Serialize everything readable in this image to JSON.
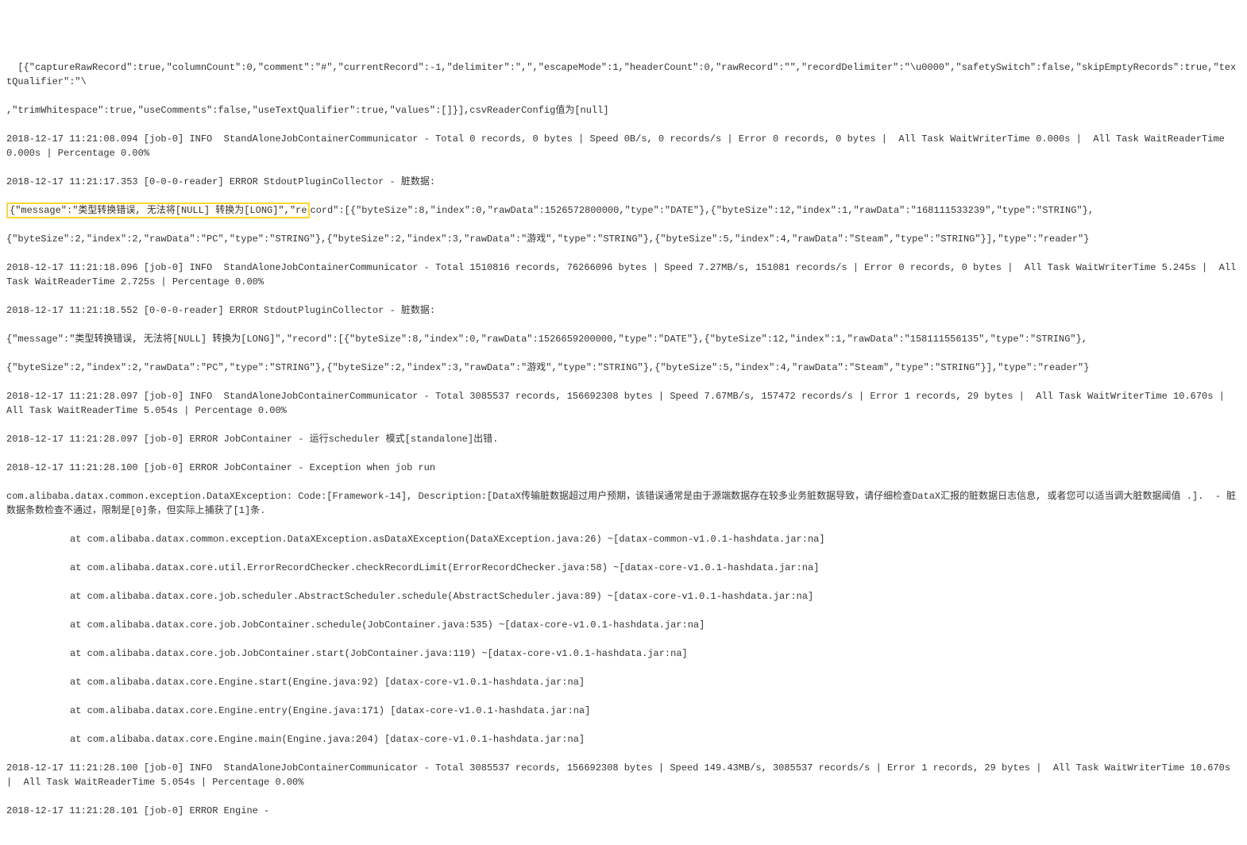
{
  "lines": {
    "l0": "  [{\"captureRawRecord\":true,\"columnCount\":0,\"comment\":\"#\",\"currentRecord\":-1,\"delimiter\":\",\",\"escapeMode\":1,\"headerCount\":0,\"rawRecord\":\"\",\"recordDelimiter\":\"\\u0000\",\"safetySwitch\":false,\"skipEmptyRecords\":true,\"textQualifier\":\"\\",
    "l1": ",\"trimWhitespace\":true,\"useComments\":false,\"useTextQualifier\":true,\"values\":[]}],csvReaderConfig值为[null]",
    "l2": "2018-12-17 11:21:08.094 [job-0] INFO  StandAloneJobContainerCommunicator - Total 0 records, 0 bytes | Speed 0B/s, 0 records/s | Error 0 records, 0 bytes |  All Task WaitWriterTime 0.000s |  All Task WaitReaderTime 0.000s | Percentage 0.00%",
    "l3_a": "2018-12-17 11:21:17.353 [0-0-0-reader] ERROR StdoutPluginCollector - 脏数据:",
    "l4_hl": "{\"message\":\"类型转换错误, 无法将[NULL] 转换为[LONG]\",\"re",
    "l4_rest": "cord\":[{\"byteSize\":8,\"index\":0,\"rawData\":1526572800000,\"type\":\"DATE\"},{\"byteSize\":12,\"index\":1,\"rawData\":\"168111533239\",\"type\":\"STRING\"},",
    "l5": "{\"byteSize\":2,\"index\":2,\"rawData\":\"PC\",\"type\":\"STRING\"},{\"byteSize\":2,\"index\":3,\"rawData\":\"游戏\",\"type\":\"STRING\"},{\"byteSize\":5,\"index\":4,\"rawData\":\"Steam\",\"type\":\"STRING\"}],\"type\":\"reader\"}",
    "l6": "2018-12-17 11:21:18.096 [job-0] INFO  StandAloneJobContainerCommunicator - Total 1510816 records, 76266096 bytes | Speed 7.27MB/s, 151081 records/s | Error 0 records, 0 bytes |  All Task WaitWriterTime 5.245s |  All Task WaitReaderTime 2.725s | Percentage 0.00%",
    "l7": "2018-12-17 11:21:18.552 [0-0-0-reader] ERROR StdoutPluginCollector - 脏数据:",
    "l8": "{\"message\":\"类型转换错误, 无法将[NULL] 转换为[LONG]\",\"record\":[{\"byteSize\":8,\"index\":0,\"rawData\":1526659200000,\"type\":\"DATE\"},{\"byteSize\":12,\"index\":1,\"rawData\":\"158111556135\",\"type\":\"STRING\"},",
    "l9": "{\"byteSize\":2,\"index\":2,\"rawData\":\"PC\",\"type\":\"STRING\"},{\"byteSize\":2,\"index\":3,\"rawData\":\"游戏\",\"type\":\"STRING\"},{\"byteSize\":5,\"index\":4,\"rawData\":\"Steam\",\"type\":\"STRING\"}],\"type\":\"reader\"}",
    "l10": "2018-12-17 11:21:28.097 [job-0] INFO  StandAloneJobContainerCommunicator - Total 3085537 records, 156692308 bytes | Speed 7.67MB/s, 157472 records/s | Error 1 records, 29 bytes |  All Task WaitWriterTime 10.670s |  All Task WaitReaderTime 5.054s | Percentage 0.00%",
    "l11": "2018-12-17 11:21:28.097 [job-0] ERROR JobContainer - 运行scheduler 模式[standalone]出错.",
    "l12": "2018-12-17 11:21:28.100 [job-0] ERROR JobContainer - Exception when job run",
    "l13": "com.alibaba.datax.common.exception.DataXException: Code:[Framework-14], Description:[DataX传输脏数据超过用户预期，该错误通常是由于源端数据存在较多业务脏数据导致，请仔细检查DataX汇报的脏数据日志信息, 或者您可以适当调大脏数据阈值 .].  - 脏数据条数检查不通过，限制是[0]条，但实际上捕获了[1]条.",
    "st0": "at com.alibaba.datax.common.exception.DataXException.asDataXException(DataXException.java:26) ~[datax-common-v1.0.1-hashdata.jar:na]",
    "st1": "at com.alibaba.datax.core.util.ErrorRecordChecker.checkRecordLimit(ErrorRecordChecker.java:58) ~[datax-core-v1.0.1-hashdata.jar:na]",
    "st2": "at com.alibaba.datax.core.job.scheduler.AbstractScheduler.schedule(AbstractScheduler.java:89) ~[datax-core-v1.0.1-hashdata.jar:na]",
    "st3": "at com.alibaba.datax.core.job.JobContainer.schedule(JobContainer.java:535) ~[datax-core-v1.0.1-hashdata.jar:na]",
    "st4": "at com.alibaba.datax.core.job.JobContainer.start(JobContainer.java:119) ~[datax-core-v1.0.1-hashdata.jar:na]",
    "st5": "at com.alibaba.datax.core.Engine.start(Engine.java:92) [datax-core-v1.0.1-hashdata.jar:na]",
    "st6": "at com.alibaba.datax.core.Engine.entry(Engine.java:171) [datax-core-v1.0.1-hashdata.jar:na]",
    "st7": "at com.alibaba.datax.core.Engine.main(Engine.java:204) [datax-core-v1.0.1-hashdata.jar:na]",
    "l14": "2018-12-17 11:21:28.100 [job-0] INFO  StandAloneJobContainerCommunicator - Total 3085537 records, 156692308 bytes | Speed 149.43MB/s, 3085537 records/s | Error 1 records, 29 bytes |  All Task WaitWriterTime 10.670s |  All Task WaitReaderTime 5.054s | Percentage 0.00%",
    "l15": "2018-12-17 11:21:28.101 [job-0] ERROR Engine -"
  }
}
